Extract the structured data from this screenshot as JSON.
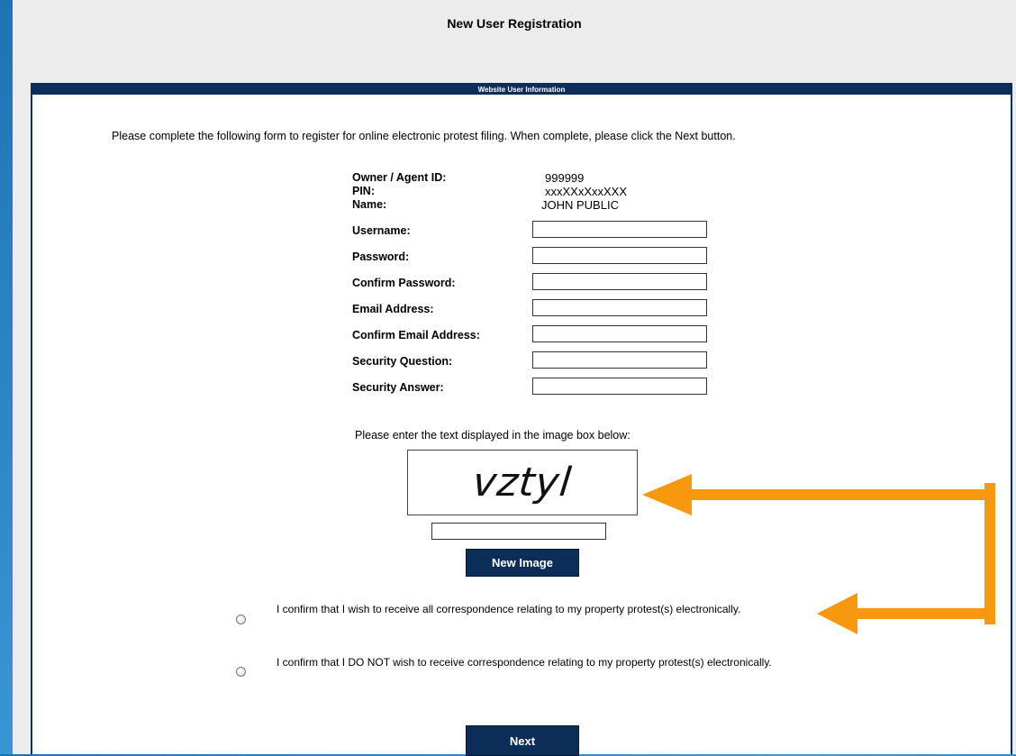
{
  "page": {
    "title": "New User Registration"
  },
  "panel": {
    "header": "Website User Information",
    "intro": "Please complete the following form to register for online electronic protest filing. When complete, please click the Next button."
  },
  "info": {
    "owner_label": "Owner / Agent ID:",
    "owner_value": "999999",
    "pin_label": "PIN:",
    "pin_value": "xxxXXxXxxXXX",
    "name_label": "Name:",
    "name_value": "JOHN PUBLIC"
  },
  "fields": {
    "username_label": "Username:",
    "password_label": "Password:",
    "confirm_password_label": "Confirm Password:",
    "email_label": "Email Address:",
    "confirm_email_label": "Confirm Email Address:",
    "security_question_label": "Security Question:",
    "security_answer_label": "Security Answer:"
  },
  "captcha": {
    "prompt": "Please enter the text displayed in the image box below:",
    "image_text": "vztyl",
    "new_image_label": "New Image"
  },
  "consent": {
    "option_yes": "I confirm that I wish to receive all correspondence relating to my property protest(s) electronically.",
    "option_no": "I confirm that I DO NOT wish to receive correspondence relating to my property protest(s) electronically."
  },
  "actions": {
    "next_label": "Next"
  },
  "colors": {
    "navy": "#0c2d58",
    "arrow": "#f7980f"
  },
  "annotation": {
    "icon": "orange-connector-arrows"
  }
}
